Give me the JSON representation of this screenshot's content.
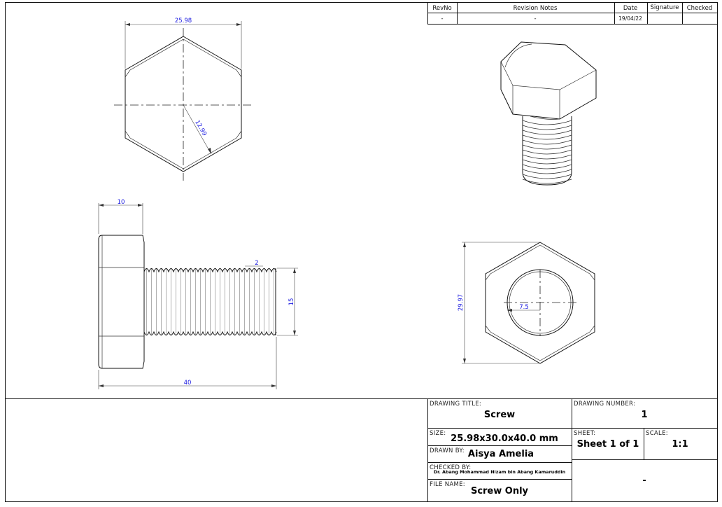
{
  "revision_table": {
    "headers": [
      "RevNo",
      "Revision Notes",
      "Date",
      "Signature",
      "Checked"
    ],
    "row": [
      "-",
      "-",
      "19/04/22",
      "",
      ""
    ]
  },
  "dimensions": {
    "top_width": "25.98",
    "top_radius": "12.99",
    "side_head": "10",
    "side_pitch": "2",
    "side_dia": "15",
    "side_length": "40",
    "end_height": "29.97",
    "end_radius": "7.5"
  },
  "title_block": {
    "drawing_title_label": "DRAWING TITLE:",
    "drawing_title": "Screw",
    "drawing_number_label": "DRAWING NUMBER:",
    "drawing_number": "1",
    "size_label": "SIZE:",
    "size": "25.98x30.0x40.0 mm",
    "sheet_label": "SHEET:",
    "sheet": "Sheet 1 of 1",
    "scale_label": "SCALE:",
    "scale": "1:1",
    "drawn_by_label": "DRAWN BY:",
    "drawn_by": "Aisya Amelia",
    "checked_by_label": "CHECKED BY:",
    "checked_by": "Dr. Abang Mohammad Nizam bin Abang Kamaruddin",
    "file_name_label": "FILE NAME:",
    "file_name": "Screw Only",
    "extra": "-"
  }
}
